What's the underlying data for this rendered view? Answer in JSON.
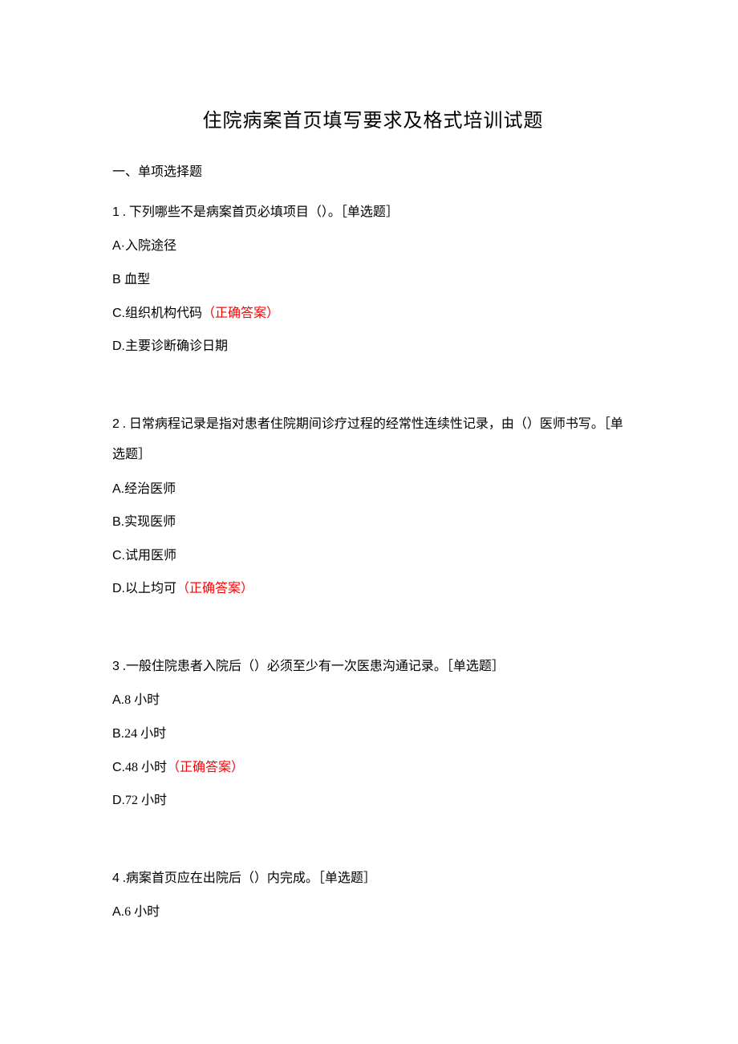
{
  "title": "住院病案首页填写要求及格式培训试题",
  "section_header": "一、单项选择题",
  "questions": [
    {
      "num": "1",
      "text": " . 下列哪些不是病案首页必填项目（）。［单选题］",
      "options": [
        {
          "label": "A·",
          "text": "入院途径",
          "correct": false
        },
        {
          "label": "B ",
          "text": "血型",
          "correct": false
        },
        {
          "label": "C.",
          "text": "组织机构代码",
          "correct": true
        },
        {
          "label": "D.",
          "text": "主要诊断确诊日期",
          "correct": false
        }
      ]
    },
    {
      "num": "2",
      "text": "  . 日常病程记录是指对患者住院期间诊疗过程的经常性连续性记录，由（）医师书写。［单选题］",
      "options": [
        {
          "label": "A.",
          "text": "经治医师",
          "correct": false
        },
        {
          "label": "B.",
          "text": "实现医师",
          "correct": false
        },
        {
          "label": "C.",
          "text": "试用医师",
          "correct": false
        },
        {
          "label": "D.",
          "text": "以上均可",
          "correct": true
        }
      ]
    },
    {
      "num": "3",
      "text": "  .一般住院患者入院后（）必须至少有一次医患沟通记录。［单选题］",
      "options": [
        {
          "label": "A.",
          "text": "8 小时",
          "correct": false
        },
        {
          "label": "B.",
          "text": "24 小时",
          "correct": false
        },
        {
          "label": "C.",
          "text": "48 小时",
          "correct": true
        },
        {
          "label": "D.",
          "text": "72 小时",
          "correct": false
        }
      ]
    },
    {
      "num": "4",
      "text": "  .病案首页应在出院后（）内完成。［单选题］",
      "options": [
        {
          "label": "A.",
          "text": "6 小时",
          "correct": false
        }
      ]
    }
  ],
  "answer_marker": "（正确答案）"
}
